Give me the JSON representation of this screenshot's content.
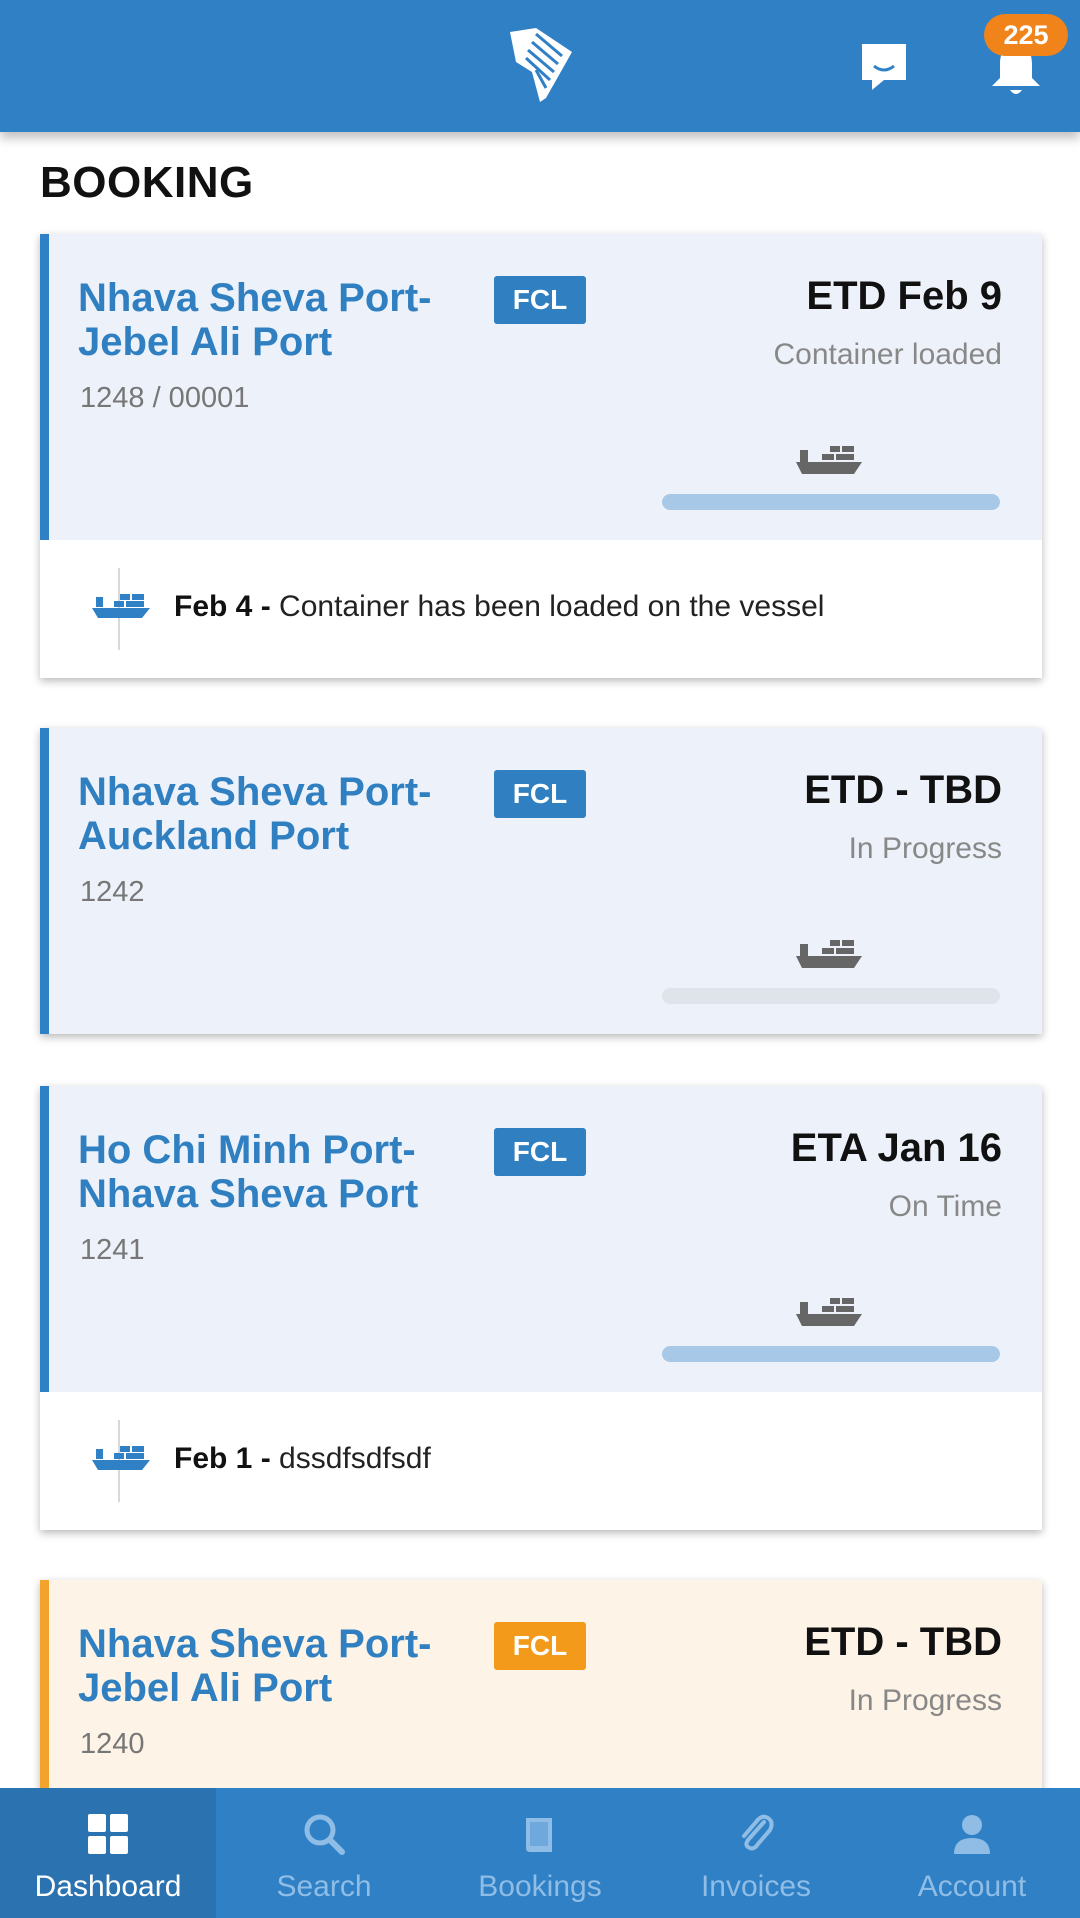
{
  "header": {
    "notification_count": "225",
    "brand_color": "#2f80c5",
    "icons": [
      "logo-icon",
      "chat-icon",
      "bell-icon"
    ]
  },
  "page": {
    "title": "BOOKING"
  },
  "bookings": [
    {
      "route": "Nhava Sheva Port-\nJebel Ali Port",
      "ref": "1248 / 00001",
      "tag": "FCL",
      "eta": "ETD Feb 9",
      "status": "Container loaded",
      "progress": 1.0,
      "event": {
        "date": "Feb 4",
        "sep": " - ",
        "text": "Container has been loaded on the vessel"
      }
    },
    {
      "route": "Nhava Sheva Port-\nAuckland Port",
      "ref": "1242",
      "tag": "FCL",
      "eta": "ETD - TBD",
      "status": "In Progress",
      "progress": 0.0
    },
    {
      "route": "Ho Chi Minh Port-\nNhava Sheva Port",
      "ref": "1241",
      "tag": "FCL",
      "eta": "ETA Jan 16",
      "status": "On Time",
      "progress": 1.0,
      "event": {
        "date": "Feb 1",
        "sep": " - ",
        "text": "dssdfsdfsdf"
      }
    },
    {
      "route": "Nhava Sheva Port-\nJebel Ali Port",
      "ref": "1240",
      "tag": "FCL",
      "eta": "ETD - TBD",
      "status": "In Progress",
      "accent": "orange"
    }
  ],
  "nav": [
    {
      "label": "Dashboard",
      "icon": "dashboard-icon",
      "active": true
    },
    {
      "label": "Search",
      "icon": "search-icon",
      "active": false
    },
    {
      "label": "Bookings",
      "icon": "book-icon",
      "active": false
    },
    {
      "label": "Invoices",
      "icon": "paperclip-icon",
      "active": false
    },
    {
      "label": "Account",
      "icon": "user-icon",
      "active": false
    }
  ]
}
